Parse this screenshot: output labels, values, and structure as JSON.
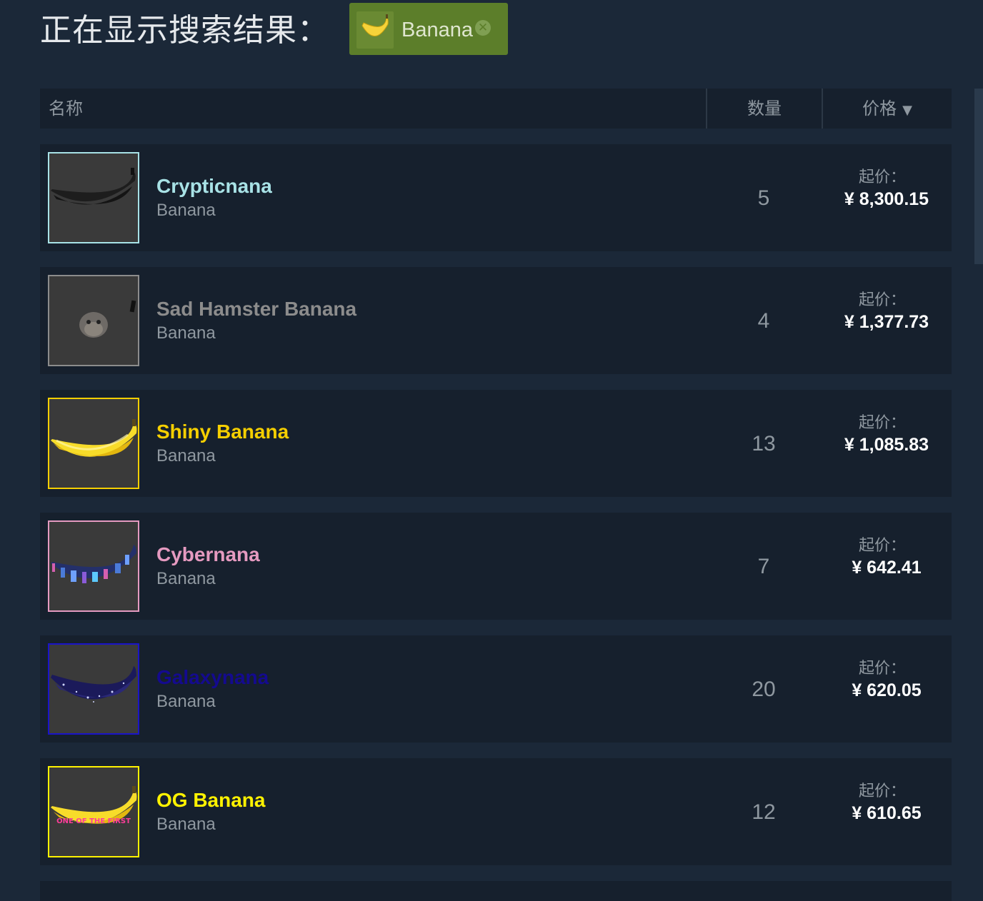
{
  "header": {
    "results_label": "正在显示搜索结果：",
    "filter_chip": {
      "label": "Banana",
      "close_icon": "close-circle-icon"
    }
  },
  "table": {
    "columns": {
      "name": "名称",
      "quantity": "数量",
      "price": "价格"
    },
    "sort_icon": "sort-descending-icon",
    "rows": [
      {
        "name": "Crypticnana",
        "game": "Banana",
        "quantity": "5",
        "price_label": "起价：",
        "price": "¥ 8,300.15",
        "name_color": "#a8e2e6",
        "border_color": "#a8e2e6",
        "image": "black-banana-image"
      },
      {
        "name": "Sad Hamster Banana",
        "game": "Banana",
        "quantity": "4",
        "price_label": "起价：",
        "price": "¥ 1,377.73",
        "name_color": "#8c8c8c",
        "border_color": "#8c8c8c",
        "image": "hamster-image"
      },
      {
        "name": "Shiny Banana",
        "game": "Banana",
        "quantity": "13",
        "price_label": "起价：",
        "price": "¥ 1,085.83",
        "name_color": "#f5cf00",
        "border_color": "#f5cf00",
        "image": "yellow-banana-image"
      },
      {
        "name": "Cybernana",
        "game": "Banana",
        "quantity": "7",
        "price_label": "起价：",
        "price": "¥ 642.41",
        "name_color": "#e59ac0",
        "border_color": "#e59ac0",
        "image": "cyber-banana-image"
      },
      {
        "name": "Galaxynana",
        "game": "Banana",
        "quantity": "20",
        "price_label": "起价：",
        "price": "¥ 620.05",
        "name_color": "#140a8f",
        "border_color": "#1a14c8",
        "image": "galaxy-banana-image"
      },
      {
        "name": "OG Banana",
        "game": "Banana",
        "quantity": "12",
        "price_label": "起价：",
        "price": "¥ 610.65",
        "name_color": "#fff200",
        "border_color": "#fff200",
        "image": "og-banana-image",
        "image_text": "ONE OF THE FIRST"
      }
    ]
  },
  "colors": {
    "background": "#1b2838",
    "row_background": "#16202d",
    "chip_background": "#5c7e2a",
    "muted_text": "#8f98a0"
  }
}
